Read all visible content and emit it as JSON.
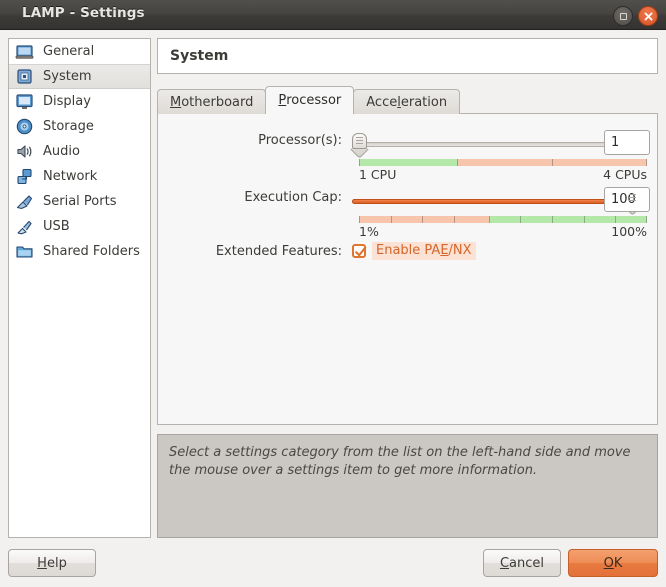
{
  "window": {
    "title": "LAMP - Settings",
    "buttons": [
      {
        "name": "maximize",
        "icon": "square-icon"
      },
      {
        "name": "close",
        "icon": "close-icon"
      }
    ]
  },
  "sidebar": {
    "items": [
      {
        "label": "General",
        "icon": "monitor-icon",
        "selected": false
      },
      {
        "label": "System",
        "icon": "chip-icon",
        "selected": true
      },
      {
        "label": "Display",
        "icon": "display-icon",
        "selected": false
      },
      {
        "label": "Storage",
        "icon": "disc-icon",
        "selected": false
      },
      {
        "label": "Audio",
        "icon": "speaker-icon",
        "selected": false
      },
      {
        "label": "Network",
        "icon": "network-icon",
        "selected": false
      },
      {
        "label": "Serial Ports",
        "icon": "serial-port-icon",
        "selected": false
      },
      {
        "label": "USB",
        "icon": "usb-icon",
        "selected": false
      },
      {
        "label": "Shared Folders",
        "icon": "folder-icon",
        "selected": false
      }
    ]
  },
  "header": {
    "title": "System"
  },
  "tabs": [
    {
      "label": "Motherboard",
      "mnemonic": "M",
      "active": false
    },
    {
      "label": "Processor",
      "mnemonic": "P",
      "active": true
    },
    {
      "label": "Acceleration",
      "mnemonic": "l",
      "active": false
    }
  ],
  "processor_tab": {
    "processors": {
      "label": "Processor(s):",
      "value": "1",
      "slider_percent": 0,
      "scale_min_label": "1 CPU",
      "scale_max_label": "4 CPUs",
      "green_percent": 34,
      "green_color": "#b4e8a8",
      "red_color": "#f6c5ab",
      "tick_percents": [
        0,
        34,
        67,
        100
      ]
    },
    "execution_cap": {
      "label": "Execution Cap:",
      "value": "100",
      "slider_percent": 100,
      "scale_min_label": "1%",
      "scale_max_label": "100%",
      "red_percent": 45,
      "green_color": "#b4e8a8",
      "red_color": "#f6c5ab",
      "tick_percents": [
        0,
        11,
        22,
        33,
        45,
        56,
        67,
        78,
        89,
        100
      ]
    },
    "extended_features": {
      "label": "Extended Features:",
      "checkbox_label_pre": "Enable PA",
      "checkbox_label_mnemonic": "E",
      "checkbox_label_post": "/NX",
      "checked": true
    }
  },
  "info_pane": {
    "text": "Select a settings category from the list on the left-hand side and move the mouse over a settings item to get more information."
  },
  "footer": {
    "help": {
      "pre": "",
      "mnemonic": "H",
      "post": "elp"
    },
    "cancel": {
      "pre": "",
      "mnemonic": "C",
      "post": "ancel"
    },
    "ok": {
      "pre": "",
      "mnemonic": "O",
      "post": "K"
    }
  },
  "colors": {
    "accent_orange": "#e4703a",
    "titlebar": "#474542",
    "panel_bg": "#f2f1f0",
    "content_bg": "#f7f7f7",
    "info_bg": "#cbc8c3"
  }
}
